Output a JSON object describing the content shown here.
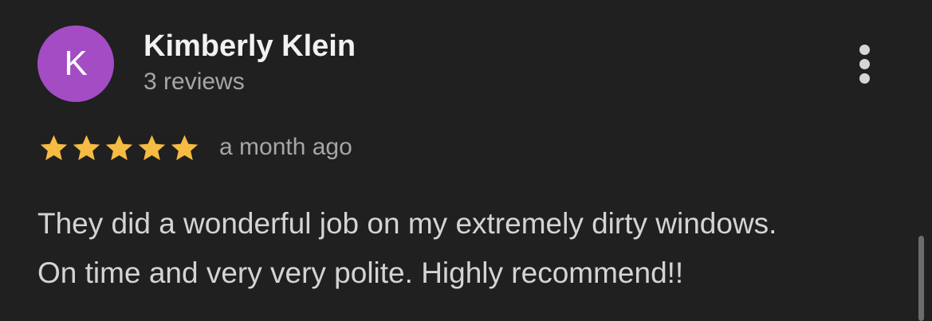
{
  "review": {
    "avatar_initial": "K",
    "avatar_color": "#a44cc4",
    "author_name": "Kimberly Klein",
    "author_review_count": "3 reviews",
    "rating": 5,
    "rating_max": 5,
    "star_color": "#f6bb42",
    "time_ago": "a month ago",
    "text_lines": [
      "They did a wonderful job on my extremely dirty windows.",
      "On time and very very polite. Highly recommend!!"
    ]
  },
  "icons": {
    "more_menu": "more-vert-icon",
    "star": "star-icon"
  }
}
